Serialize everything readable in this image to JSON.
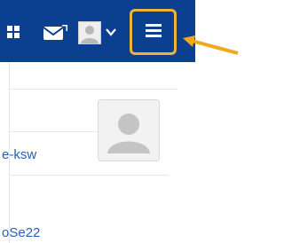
{
  "navbar": {
    "icons": [
      "apps-grid-icon",
      "mail-icon",
      "user-avatar-icon",
      "chevron-down-icon",
      "hamburger-menu-icon"
    ]
  },
  "content": {
    "link_1": "e-ksw",
    "link_2": "oSe22"
  },
  "colors": {
    "navbar_bg": "#0b3f8f",
    "highlight_border": "#f2b233",
    "arrow": "#f2a81d",
    "link": "#2a5fb3"
  }
}
